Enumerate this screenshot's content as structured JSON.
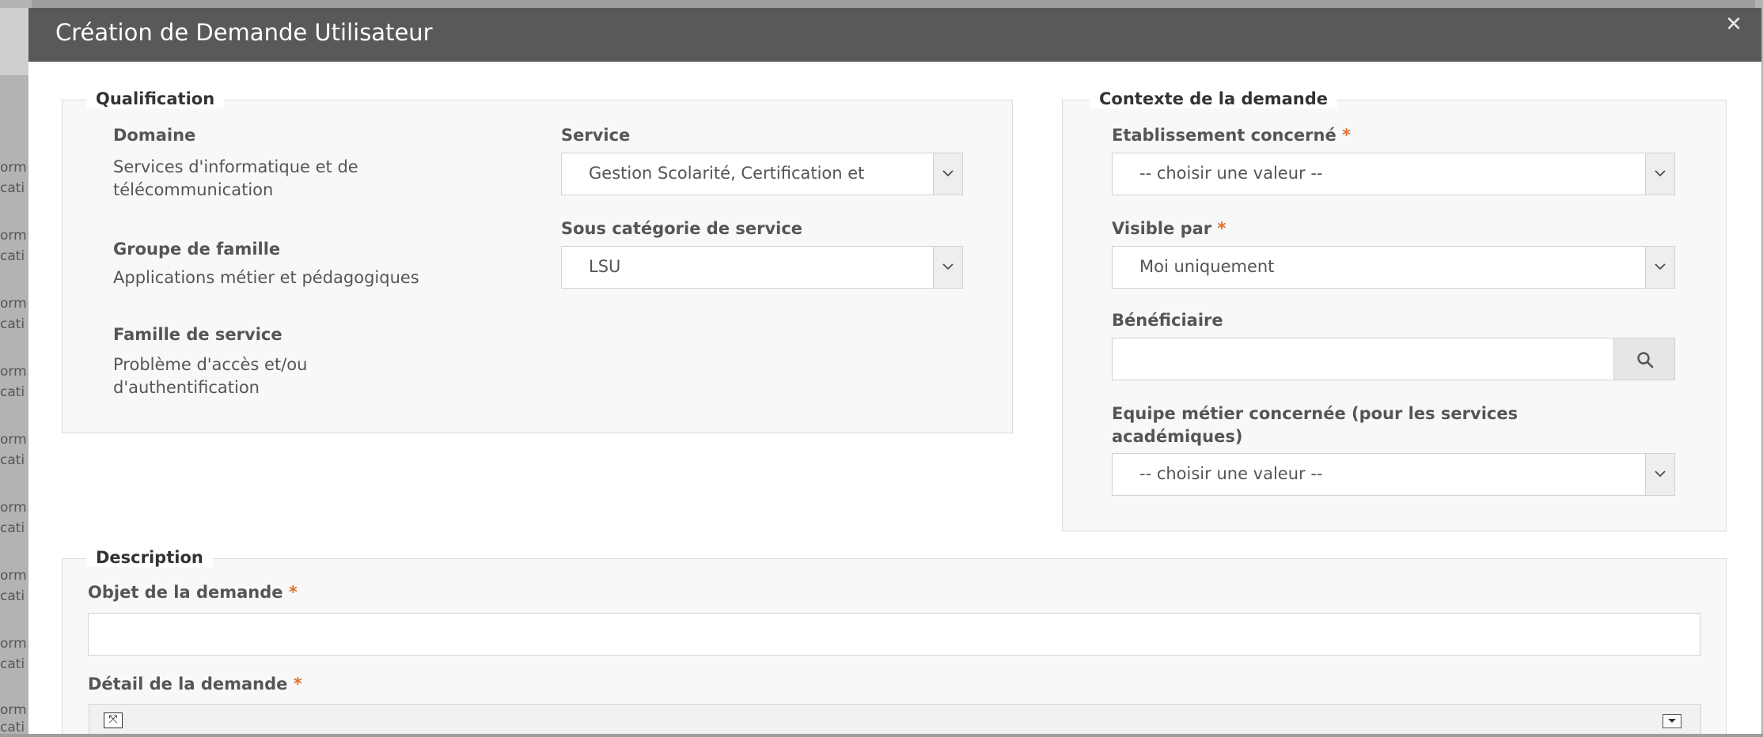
{
  "background_rows": [
    "orm",
    "cati",
    "orm",
    "cati",
    "orm",
    "cati",
    "orm",
    "cati",
    "orm",
    "cati",
    "orm",
    "cati",
    "orm",
    "cati",
    "orm",
    "cati",
    "orm",
    "cati"
  ],
  "modal": {
    "title": "Création de Demande Utilisateur",
    "close_icon": "close-icon"
  },
  "qualification": {
    "legend": "Qualification",
    "domaine_label": "Domaine",
    "domaine_value_line1": "Services d'informatique et de",
    "domaine_value_line2": "télécommunication",
    "groupe_label": "Groupe de famille",
    "groupe_value": "Applications métier et pédagogiques",
    "famille_label": "Famille de service",
    "famille_value_line1": "Problème d'accès et/ou",
    "famille_value_line2": "d'authentification",
    "service_label": "Service",
    "service_value": "Gestion Scolarité, Certification et",
    "sous_cat_label": "Sous catégorie de service",
    "sous_cat_value": "LSU"
  },
  "contexte": {
    "legend": "Contexte de la demande",
    "etablissement_label": "Etablissement concerné",
    "etablissement_value": "-- choisir une valeur --",
    "visible_label": "Visible par",
    "visible_value": "Moi uniquement",
    "beneficiaire_label": "Bénéficiaire",
    "beneficiaire_value": "",
    "equipe_label_line1": "Equipe métier concernée (pour les services",
    "equipe_label_line2": "académiques)",
    "equipe_value": "-- choisir une valeur --",
    "required_mark": "*"
  },
  "description": {
    "legend": "Description",
    "objet_label": "Objet de la demande",
    "objet_value": "",
    "detail_label": "Détail de la demande",
    "required_mark": "*"
  },
  "colors": {
    "header_bg": "#595959",
    "required": "#e0712b",
    "fieldset_bg": "#f8f8f8"
  }
}
